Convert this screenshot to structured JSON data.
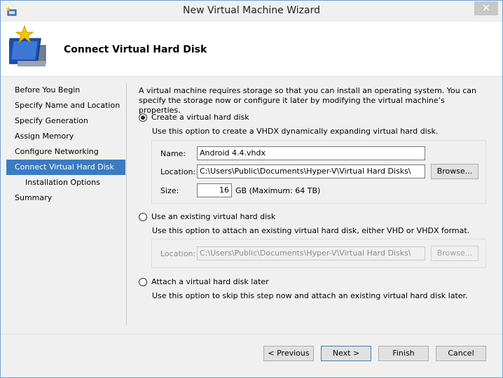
{
  "window": {
    "title": "New Virtual Machine Wizard",
    "close_glyph": "✕"
  },
  "header": {
    "title": "Connect Virtual Hard Disk"
  },
  "nav": {
    "items": [
      {
        "label": "Before You Begin"
      },
      {
        "label": "Specify Name and Location"
      },
      {
        "label": "Specify Generation"
      },
      {
        "label": "Assign Memory"
      },
      {
        "label": "Configure Networking"
      },
      {
        "label": "Connect Virtual Hard Disk"
      },
      {
        "label": "Installation Options"
      },
      {
        "label": "Summary"
      }
    ],
    "active_index": 5
  },
  "content": {
    "intro": "A virtual machine requires storage so that you can install an operating system. You can specify the storage now or configure it later by modifying the virtual machine’s properties.",
    "create": {
      "label": "Create a virtual hard disk",
      "description": "Use this option to create a VHDX dynamically expanding virtual hard disk.",
      "selected": true,
      "name_label": "Name:",
      "name_value": "Android 4.4.vhdx",
      "location_label": "Location:",
      "location_value": "C:\\Users\\Public\\Documents\\Hyper-V\\Virtual Hard Disks\\",
      "browse_label": "Browse...",
      "size_label": "Size:",
      "size_value": "16",
      "size_unit": "GB (Maximum: 64 TB)"
    },
    "existing": {
      "label": "Use an existing virtual hard disk",
      "description": "Use this option to attach an existing virtual hard disk, either VHD or VHDX format.",
      "selected": false,
      "location_label": "Location:",
      "location_value": "C:\\Users\\Public\\Documents\\Hyper-V\\Virtual Hard Disks\\",
      "browse_label": "Browse..."
    },
    "later": {
      "label": "Attach a virtual hard disk later",
      "description": "Use this option to skip this step now and attach an existing virtual hard disk later.",
      "selected": false
    }
  },
  "footer": {
    "previous_label": "< Previous",
    "next_label": "Next >",
    "finish_label": "Finish",
    "cancel_label": "Cancel"
  },
  "colors": {
    "accent": "#3b7bc2",
    "window_border": "#6e9fd0"
  }
}
